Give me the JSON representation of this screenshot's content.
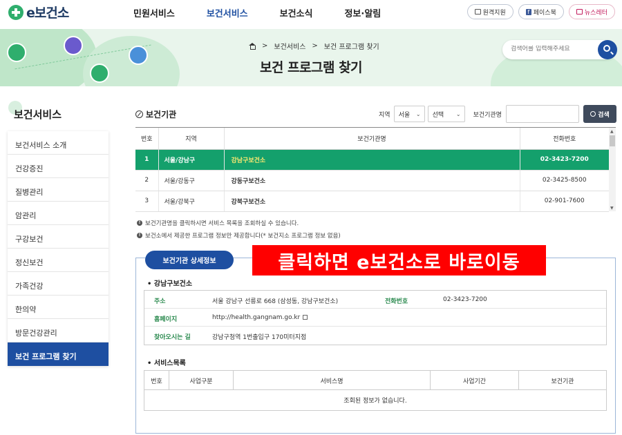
{
  "header": {
    "logo": "e보건소",
    "nav": [
      "민원서비스",
      "보건서비스",
      "보건소식",
      "정보·알림"
    ],
    "nav_active": "보건서비스",
    "util": [
      "원격지원",
      "페이스북",
      "뉴스레터"
    ]
  },
  "hero": {
    "breadcrumb": [
      "보건서비스",
      "보건 프로그램 찾기"
    ],
    "title": "보건 프로그램 찾기",
    "search_placeholder": "검색어를 입력해주세요"
  },
  "sidebar": {
    "title": "보건서비스",
    "items": [
      "보건서비스 소개",
      "건강증진",
      "질병관리",
      "암관리",
      "구강보건",
      "정신보건",
      "가족건강",
      "한의약",
      "방문건강관리",
      "보건 프로그램 찾기"
    ],
    "active_index": 9
  },
  "main": {
    "section_title": "보건기관",
    "filter": {
      "region_label": "지역",
      "region_value": "서울",
      "sub_value": "선택",
      "org_label": "보건기관명",
      "search_btn": "검색"
    },
    "table": {
      "headers": [
        "번호",
        "지역",
        "보건기관명",
        "전화번호"
      ],
      "rows": [
        {
          "no": "1",
          "region": "서울/강남구",
          "name": "강남구보건소",
          "tel": "02-3423-7200"
        },
        {
          "no": "2",
          "region": "서울/강동구",
          "name": "강동구보건소",
          "tel": "02-3425-8500"
        },
        {
          "no": "3",
          "region": "서울/강북구",
          "name": "강북구보건소",
          "tel": "02-901-7600"
        }
      ],
      "selected_index": 0
    },
    "notes": [
      "보건기관명을 클릭하시면 서비스 목록을 조회하실 수 있습니다.",
      "보건소에서 제공한 프로그램 정보만 제공합니다(* 보건지소 프로그램 정보 없음)"
    ],
    "detail": {
      "tab": "보건기관 상세정보",
      "overlay": "클릭하면 e보건소로 바로이동",
      "org_name": "강남구보건소",
      "address_label": "주소",
      "address": "서울 강남구 선릉로 668 (삼성동, 강남구보건소)",
      "tel_label": "전화번호",
      "tel": "02-3423-7200",
      "home_label": "홈페이지",
      "home": "http://health.gangnam.go.kr",
      "way_label": "찾아오시는 길",
      "way": "강남구청역 1번출입구 170미터지점"
    },
    "services": {
      "title": "서비스목록",
      "headers": [
        "번호",
        "사업구분",
        "서비스명",
        "사업기간",
        "보건기관"
      ],
      "empty": "조회된 정보가 없습니다."
    }
  },
  "colors": {
    "primary": "#1e4fa1",
    "selected_row": "#14a06c",
    "overlay": "#ff0000",
    "hero_bg": "#e9f5ec"
  }
}
